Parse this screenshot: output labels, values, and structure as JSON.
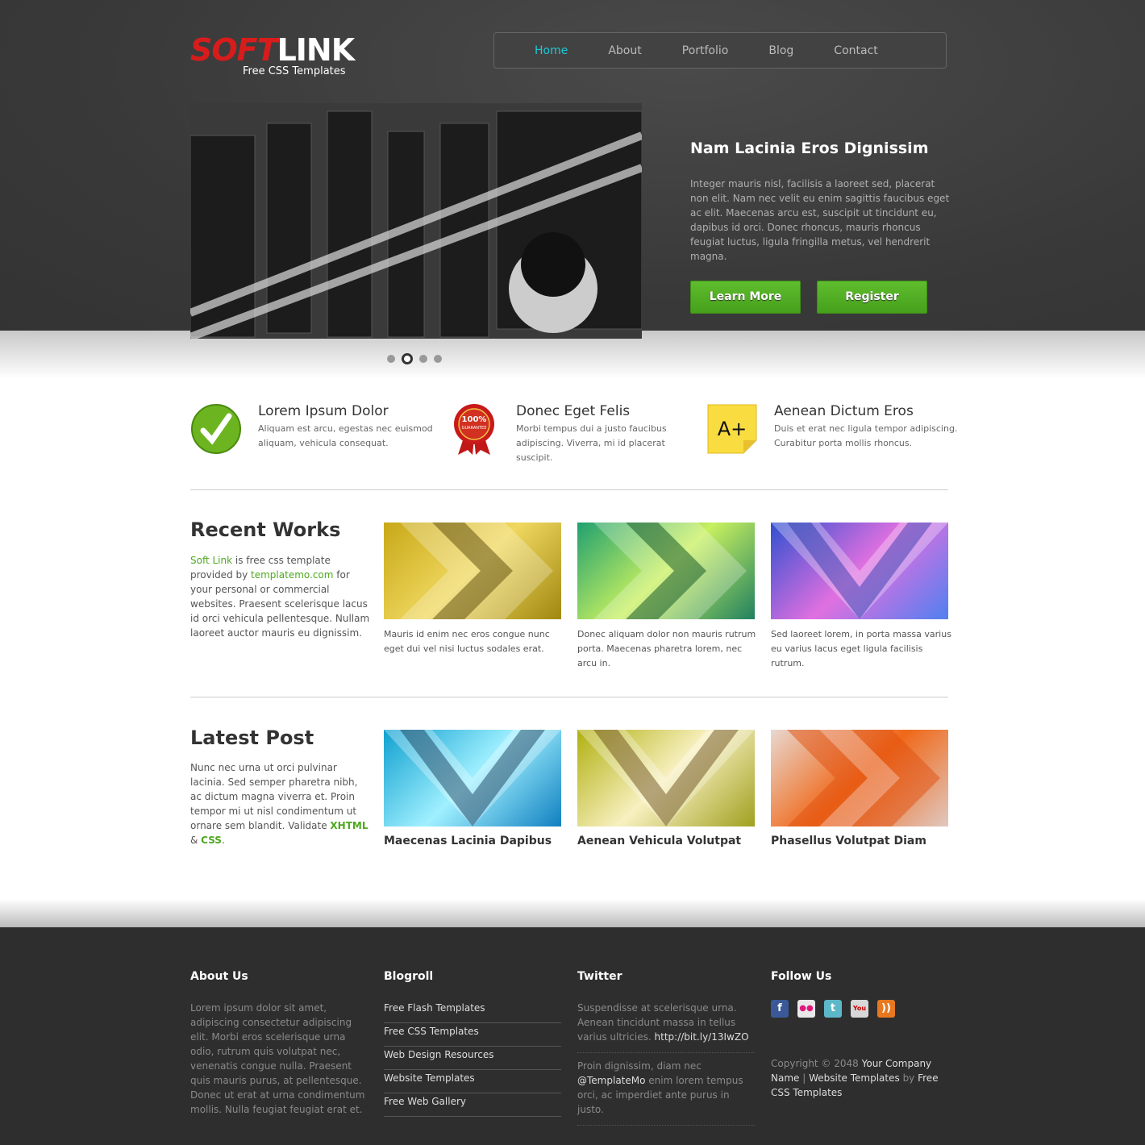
{
  "logo": {
    "brand_red": "SOFT",
    "brand_white": "LINK",
    "tagline": "Free CSS Templates"
  },
  "nav": [
    {
      "label": "Home",
      "active": true
    },
    {
      "label": "About"
    },
    {
      "label": "Portfolio"
    },
    {
      "label": "Blog"
    },
    {
      "label": "Contact"
    }
  ],
  "hero": {
    "title": "Nam Lacinia Eros Dignissim",
    "text": "Integer mauris nisl, facilisis a laoreet sed, placerat non elit. Nam nec velit eu enim sagittis faucibus eget ac elit. Maecenas arcu est, suscipit ut tincidunt eu, dapibus id orci. Donec rhoncus, mauris rhoncus feugiat luctus, ligula fringilla metus, vel hendrerit magna.",
    "learn_more": "Learn More",
    "register": "Register",
    "slide_count": 4,
    "active_slide": 2
  },
  "features": [
    {
      "icon": "checkmark-icon",
      "title": "Lorem Ipsum Dolor",
      "text": "Aliquam est arcu, egestas nec euismod aliquam, vehicula consequat."
    },
    {
      "icon": "guarantee-badge-icon",
      "badge": "100% GUARANTEE",
      "title": "Donec Eget Felis",
      "text": "Morbi tempus dui a justo faucibus adipiscing. Viverra, mi id placerat suscipit."
    },
    {
      "icon": "a-plus-note-icon",
      "badge": "A+",
      "title": "Aenean Dictum Eros",
      "text": "Duis et erat nec ligula tempor adipiscing. Curabitur porta mollis rhoncus."
    }
  ],
  "recent": {
    "title": "Recent Works",
    "link1": "Soft Link",
    "t1": " is free css template provided by ",
    "link2": "templatemo.com",
    "t2": " for your personal or commercial websites. Praesent scelerisque lacus id orci vehicula pellentesque. Nullam laoreet auctor mauris eu dignissim.",
    "items": [
      {
        "caption": "Mauris id enim nec eros congue nunc eget dui vel nisi luctus sodales erat."
      },
      {
        "caption": "Donec aliquam dolor non mauris rutrum porta. Maecenas pharetra lorem, nec arcu in."
      },
      {
        "caption": "Sed laoreet lorem, in porta massa varius eu varius lacus eget ligula facilisis rutrum."
      }
    ]
  },
  "latest": {
    "title": "Latest Post",
    "text": "Nunc nec urna ut orci pulvinar lacinia. Sed semper pharetra nibh, ac dictum magna viverra et. Proin tempor mi ut nisl condimentum ut ornare sem blandit. Validate ",
    "xhtml": "XHTML",
    "amp": " & ",
    "css": "CSS",
    "dot": ".",
    "items": [
      {
        "title": "Maecenas Lacinia Dapibus"
      },
      {
        "title": "Aenean Vehicula Volutpat"
      },
      {
        "title": "Phasellus Volutpat Diam"
      }
    ]
  },
  "footer": {
    "about": {
      "title": "About Us",
      "text": "Lorem ipsum dolor sit amet, adipiscing consectetur adipiscing elit. Morbi eros scelerisque urna odio, rutrum quis volutpat nec, venenatis congue nulla. Praesent quis mauris purus, at pellentesque. Donec ut erat at urna condimentum mollis. Nulla feugiat feugiat erat et."
    },
    "blogroll": {
      "title": "Blogroll",
      "links": [
        "Free Flash Templates",
        "Free CSS Templates",
        "Web Design Resources",
        "Website Templates",
        "Free Web Gallery"
      ]
    },
    "twitter": {
      "title": "Twitter",
      "t1a": "Suspendisse at scelerisque urna. Aenean tincidunt massa in tellus varius ultricies. ",
      "t1link": "http://bit.ly/13IwZO",
      "t2link": "@TemplateMo",
      "t2pre": "Proin dignissim, diam nec ",
      "t2b": " enim lorem tempus orci, ac imperdiet ante purus in justo."
    },
    "follow": {
      "title": "Follow Us",
      "icons": [
        "facebook-icon",
        "flickr-icon",
        "twitter-icon",
        "youtube-icon",
        "rss-icon"
      ],
      "copy": "Copyright © 2048 ",
      "company": "Your Company Name",
      "sep": " | ",
      "wt": "Website Templates",
      "by": " by ",
      "fct": "Free CSS Templates"
    }
  }
}
